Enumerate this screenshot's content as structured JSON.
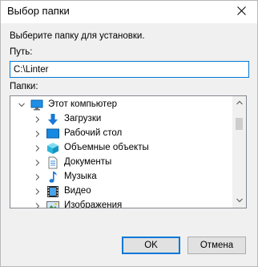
{
  "window": {
    "title": "Выбор папки"
  },
  "dialog": {
    "instruction": "Выберите папку для установки.",
    "path_label": "Путь:",
    "path_value": "C:\\Linter",
    "folders_label": "Папки:"
  },
  "tree": {
    "root": {
      "label": "Этот компьютер",
      "icon": "computer-icon"
    },
    "items": [
      {
        "label": "Загрузки",
        "icon": "downloads-icon"
      },
      {
        "label": "Рабочий стол",
        "icon": "desktop-icon"
      },
      {
        "label": "Объемные объекты",
        "icon": "3d-objects-icon"
      },
      {
        "label": "Документы",
        "icon": "documents-icon"
      },
      {
        "label": "Музыка",
        "icon": "music-icon"
      },
      {
        "label": "Видео",
        "icon": "video-icon"
      },
      {
        "label": "Изображения",
        "icon": "pictures-icon"
      }
    ]
  },
  "buttons": {
    "ok": "OK",
    "cancel": "Отмена"
  },
  "colors": {
    "accent": "#0078d7",
    "dialog_bg": "#f0f0f0"
  }
}
